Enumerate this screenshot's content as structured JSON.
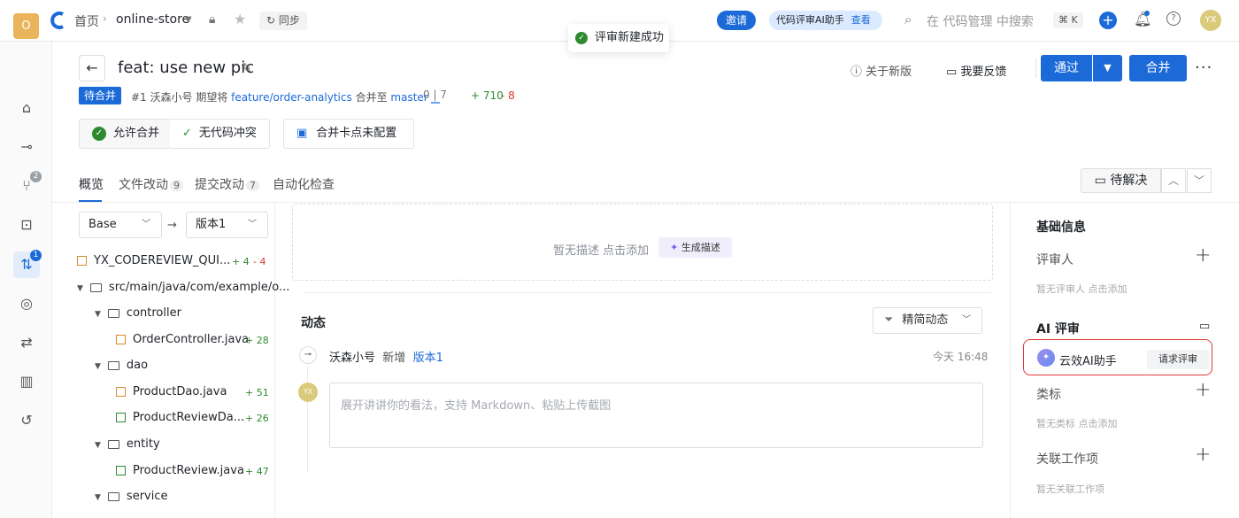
{
  "topbar": {
    "home": "首页",
    "repo": "online-store",
    "sync": "同步",
    "invite": "邀请",
    "ai_assistant": "代码评审AI助手",
    "ai_view": "查看",
    "search_placeholder": "在 代码管理 中搜索",
    "shortcut": "⌘ K",
    "user_initials": "YX"
  },
  "toast": {
    "message": "评审新建成功"
  },
  "sidebar": {
    "org_initial": "O",
    "badge_branches": "2",
    "badge_mr": "1"
  },
  "header": {
    "title": "feat: use new pic",
    "status": "待合并",
    "meta_prefix": "#1 沃森小号 期望将",
    "source_branch": "feature/order-analytics",
    "merge_to": "合并至",
    "target_branch": "master",
    "progress": "0 | 7",
    "additions": "+ 710",
    "deletions": "- 8",
    "about_new": "关于新版",
    "feedback": "我要反馈",
    "approve": "通过",
    "merge": "合并"
  },
  "checks": {
    "allow_merge": "允许合并",
    "no_conflict": "无代码冲突",
    "gate": "合并卡点未配置"
  },
  "tabs": [
    {
      "label": "概览"
    },
    {
      "label": "文件改动",
      "count": "9"
    },
    {
      "label": "提交改动",
      "count": "7"
    },
    {
      "label": "自动化检查"
    }
  ],
  "pending": "待解决",
  "compare": {
    "base": "Base",
    "version": "版本1"
  },
  "tree": [
    {
      "name": "YX_CODEREVIEW_QUI...",
      "add": "+ 4",
      "del": "- 4"
    },
    {
      "name": "src/main/java/com/example/o..."
    },
    {
      "name": "controller"
    },
    {
      "name": "OrderController.java",
      "add": "+ 28"
    },
    {
      "name": "dao"
    },
    {
      "name": "ProductDao.java",
      "add": "+ 51"
    },
    {
      "name": "ProductReviewDa...",
      "add": "+ 26"
    },
    {
      "name": "entity"
    },
    {
      "name": "ProductReview.java",
      "add": "+ 47"
    },
    {
      "name": "service"
    }
  ],
  "description": {
    "empty": "暂无描述 点击添加",
    "generate": "生成描述"
  },
  "activity": {
    "title": "动态",
    "filter": "精简动态",
    "actor": "沃森小号",
    "action": "新增",
    "target": "版本1",
    "time": "今天 16:48",
    "avatar": "YX",
    "comment_placeholder": "展开讲讲你的看法，支持 Markdown、粘贴上传截图"
  },
  "right": {
    "basic_info": "基础信息",
    "reviewers": "评审人",
    "reviewers_empty": "暂无评审人 点击添加",
    "ai_review": "AI 评审",
    "ai_name": "云效AI助手",
    "request_review": "请求评审",
    "labels": "类标",
    "labels_empty": "暂无类标 点击添加",
    "workitems": "关联工作项",
    "workitems_empty": "暂无关联工作项"
  }
}
